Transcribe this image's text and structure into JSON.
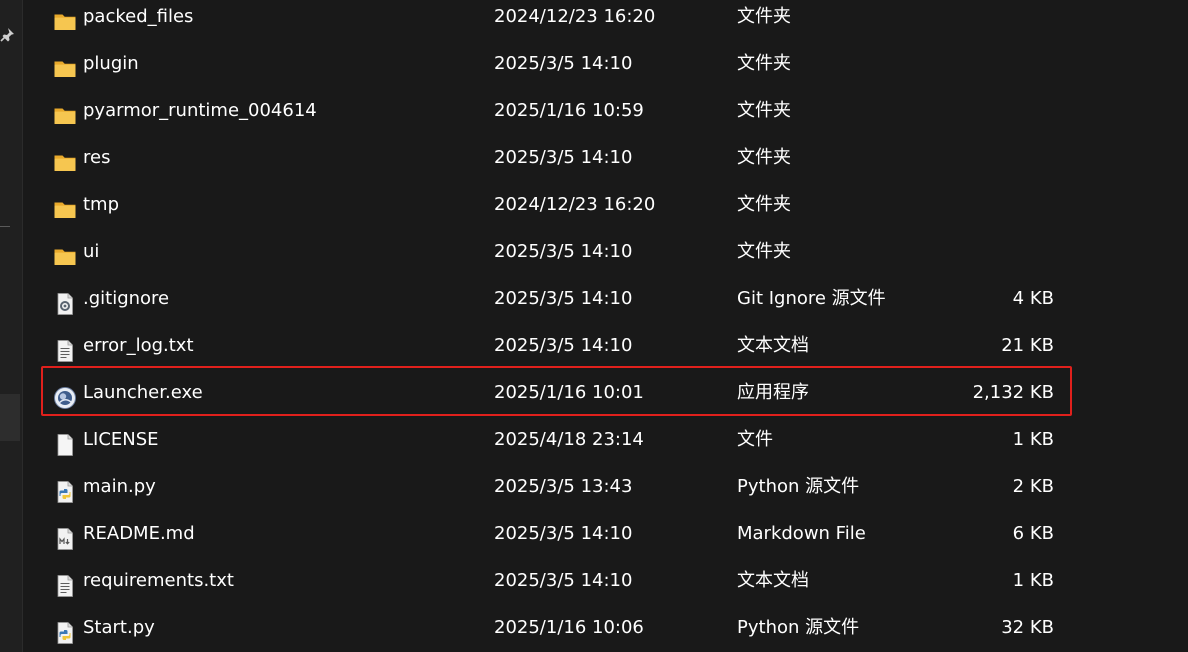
{
  "files": [
    {
      "name": "packed_files",
      "date": "2024/12/23 16:20",
      "type": "文件夹",
      "size": "",
      "icon": "folder-icon"
    },
    {
      "name": "plugin",
      "date": "2025/3/5 14:10",
      "type": "文件夹",
      "size": "",
      "icon": "folder-icon"
    },
    {
      "name": "pyarmor_runtime_004614",
      "date": "2025/1/16 10:59",
      "type": "文件夹",
      "size": "",
      "icon": "folder-icon"
    },
    {
      "name": "res",
      "date": "2025/3/5 14:10",
      "type": "文件夹",
      "size": "",
      "icon": "folder-icon"
    },
    {
      "name": "tmp",
      "date": "2024/12/23 16:20",
      "type": "文件夹",
      "size": "",
      "icon": "folder-icon"
    },
    {
      "name": "ui",
      "date": "2025/3/5 14:10",
      "type": "文件夹",
      "size": "",
      "icon": "folder-icon"
    },
    {
      "name": ".gitignore",
      "date": "2025/3/5 14:10",
      "type": "Git Ignore 源文件",
      "size": "4 KB",
      "icon": "config-file-icon"
    },
    {
      "name": "error_log.txt",
      "date": "2025/3/5 14:10",
      "type": "文本文档",
      "size": "21 KB",
      "icon": "text-file-icon"
    },
    {
      "name": "Launcher.exe",
      "date": "2025/1/16 10:01",
      "type": "应用程序",
      "size": "2,132 KB",
      "icon": "app-icon"
    },
    {
      "name": "LICENSE",
      "date": "2025/4/18 23:14",
      "type": "文件",
      "size": "1 KB",
      "icon": "blank-file-icon"
    },
    {
      "name": "main.py",
      "date": "2025/3/5 13:43",
      "type": "Python 源文件",
      "size": "2 KB",
      "icon": "python-file-icon"
    },
    {
      "name": "README.md",
      "date": "2025/3/5 14:10",
      "type": "Markdown File",
      "size": "6 KB",
      "icon": "markdown-file-icon"
    },
    {
      "name": "requirements.txt",
      "date": "2025/3/5 14:10",
      "type": "文本文档",
      "size": "1 KB",
      "icon": "text-file-icon"
    },
    {
      "name": "Start.py",
      "date": "2025/1/16 10:06",
      "type": "Python 源文件",
      "size": "32 KB",
      "icon": "python-file-icon"
    }
  ],
  "highlighted_file": "Launcher.exe",
  "colors": {
    "background": "#191919",
    "text": "#ffffff",
    "folder": "#f4c04e",
    "highlight": "#e0201c"
  }
}
